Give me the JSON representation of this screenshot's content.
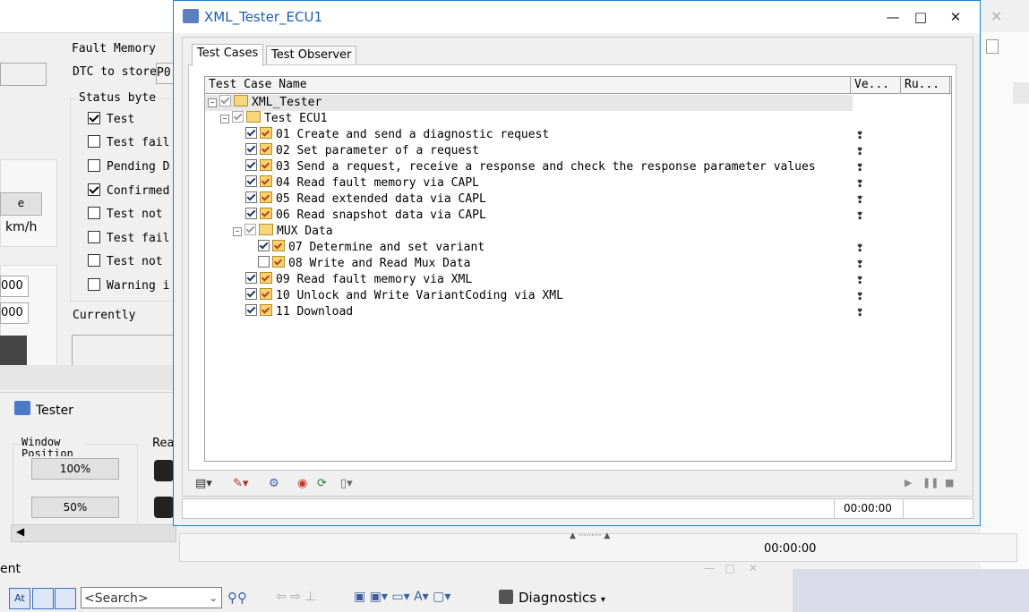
{
  "background": {
    "close_glyph": "×",
    "fault_memory": {
      "title": "Fault Memory",
      "dtc_label": "DTC to store",
      "dtc_value": "P0",
      "status_byte_title": "Status byte",
      "status_items": [
        {
          "label": "Test",
          "checked": true
        },
        {
          "label": "Test fail",
          "checked": false
        },
        {
          "label": "Pending D",
          "checked": false
        },
        {
          "label": "Confirmed",
          "checked": true
        },
        {
          "label": "Test not",
          "checked": false
        },
        {
          "label": "Test fail",
          "checked": false
        },
        {
          "label": "Test not",
          "checked": false
        },
        {
          "label": "Warning i",
          "checked": false
        }
      ],
      "currently_label": "Currently"
    },
    "left_fields": {
      "button_e": "e",
      "unit": "km/h",
      "field1": "000",
      "field2": "000"
    },
    "tester_panel": {
      "title": "Tester",
      "window_position_label": "Window Position",
      "btn_100": "100%",
      "btn_50": "50%",
      "partial_label": "Rea"
    },
    "right_panel": {
      "time": "00:00:00"
    },
    "bottom": {
      "pane_label": "ent",
      "search_placeholder": "<Search>",
      "diagnostics_label": "Diagnostics"
    }
  },
  "window": {
    "title": "XML_Tester_ECU1",
    "tabs": [
      "Test Cases",
      "Test Observer"
    ],
    "columns": [
      "Test Case Name",
      "Ve...",
      "Ru..."
    ],
    "root": "XML_Tester",
    "group": "Test ECU1",
    "items": [
      {
        "label": "01 Create and send a diagnostic request",
        "checked": true
      },
      {
        "label": "02 Set parameter of a request",
        "checked": true
      },
      {
        "label": "03 Send a request, receive a response and check the response parameter values",
        "checked": true
      },
      {
        "label": "04 Read fault memory via CAPL",
        "checked": true
      },
      {
        "label": "05 Read extended data via CAPL",
        "checked": true
      },
      {
        "label": "06 Read snapshot data via CAPL",
        "checked": true
      }
    ],
    "mux_group": "MUX Data",
    "mux_items": [
      {
        "label": "07 Determine and set variant",
        "checked": true
      },
      {
        "label": "08 Write and Read Mux Data",
        "checked": false
      }
    ],
    "tail_items": [
      {
        "label": "09 Read fault memory via XML",
        "checked": true
      },
      {
        "label": "10 Unlock and Write VariantCoding via XML",
        "checked": true
      },
      {
        "label": "11 Download",
        "checked": true
      }
    ],
    "verdict_symbol": "❢",
    "status_time": "00:00:00"
  }
}
